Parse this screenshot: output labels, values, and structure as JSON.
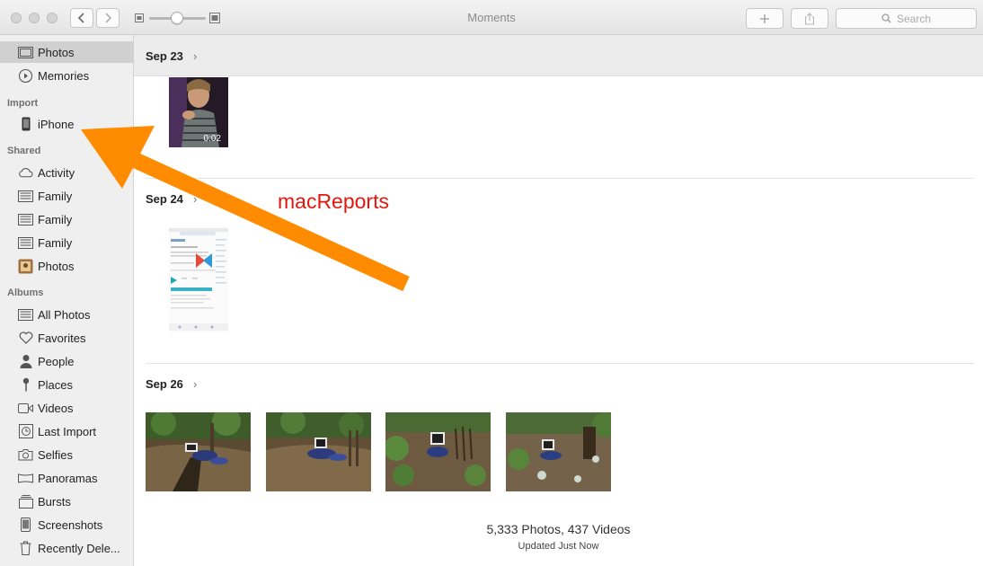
{
  "window": {
    "title": "Moments",
    "search_placeholder": "Search"
  },
  "sidebar": {
    "library": [
      {
        "label": "Photos",
        "icon": "photos-library-icon",
        "selected": true
      },
      {
        "label": "Memories",
        "icon": "memories-icon"
      }
    ],
    "import_header": "Import",
    "import_items": [
      {
        "label": "iPhone",
        "icon": "iphone-icon"
      }
    ],
    "shared_header": "Shared",
    "shared_items": [
      {
        "label": "Activity",
        "icon": "cloud-icon"
      },
      {
        "label": "Family",
        "icon": "shared-album-icon"
      },
      {
        "label": "Family",
        "icon": "shared-album-icon"
      },
      {
        "label": "Family",
        "icon": "shared-album-icon"
      },
      {
        "label": "Photos",
        "icon": "shared-photo-album-icon"
      }
    ],
    "albums_header": "Albums",
    "album_items": [
      {
        "label": "All Photos",
        "icon": "all-photos-icon"
      },
      {
        "label": "Favorites",
        "icon": "heart-icon"
      },
      {
        "label": "People",
        "icon": "person-icon"
      },
      {
        "label": "Places",
        "icon": "pin-icon"
      },
      {
        "label": "Videos",
        "icon": "video-camera-icon"
      },
      {
        "label": "Last Import",
        "icon": "clock-icon"
      },
      {
        "label": "Selfies",
        "icon": "camera-icon"
      },
      {
        "label": "Panoramas",
        "icon": "panorama-icon"
      },
      {
        "label": "Bursts",
        "icon": "bursts-icon"
      },
      {
        "label": "Screenshots",
        "icon": "screenshot-icon"
      },
      {
        "label": "Recently Dele...",
        "icon": "trash-icon"
      }
    ]
  },
  "moments": [
    {
      "date": "Sep 23",
      "video_duration": "0:02"
    },
    {
      "date": "Sep 24"
    },
    {
      "date": "Sep 26"
    }
  ],
  "footer": {
    "count": "5,333 Photos, 437 Videos",
    "status": "Updated Just Now"
  },
  "annotation": {
    "text": "macReports",
    "arrow_color": "#ff8c00",
    "text_color": "#e3170e"
  }
}
